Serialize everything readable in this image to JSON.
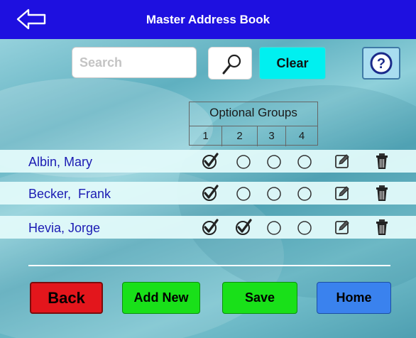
{
  "header": {
    "title": "Master Address Book"
  },
  "search": {
    "placeholder": "Search",
    "value": ""
  },
  "toolbar": {
    "clear_label": "Clear"
  },
  "groups": {
    "title": "Optional Groups",
    "numbers": [
      "1",
      "2",
      "3",
      "4"
    ]
  },
  "contacts": [
    {
      "name": "Albin, Mary",
      "groups": [
        true,
        false,
        false,
        false
      ]
    },
    {
      "name": "Becker,  Frank",
      "groups": [
        true,
        false,
        false,
        false
      ]
    },
    {
      "name": "Hevia, Jorge",
      "groups": [
        true,
        true,
        false,
        false
      ]
    }
  ],
  "buttons": {
    "back": "Back",
    "add_new": "Add New",
    "save": "Save",
    "home": "Home"
  },
  "colors": {
    "header": "#1e10e0",
    "back": "#e3161c",
    "add_new": "#19e019",
    "save": "#19e019",
    "home": "#3a82ee",
    "clear": "#00f0f0",
    "name_text": "#1b1bb3"
  },
  "icons": {
    "back": "back-arrow-icon",
    "search": "magnifier-icon",
    "help": "question-icon",
    "checked": "checkmark-circle-icon",
    "unchecked": "empty-circle-icon",
    "edit": "pencil-edit-icon",
    "delete": "trash-icon"
  }
}
